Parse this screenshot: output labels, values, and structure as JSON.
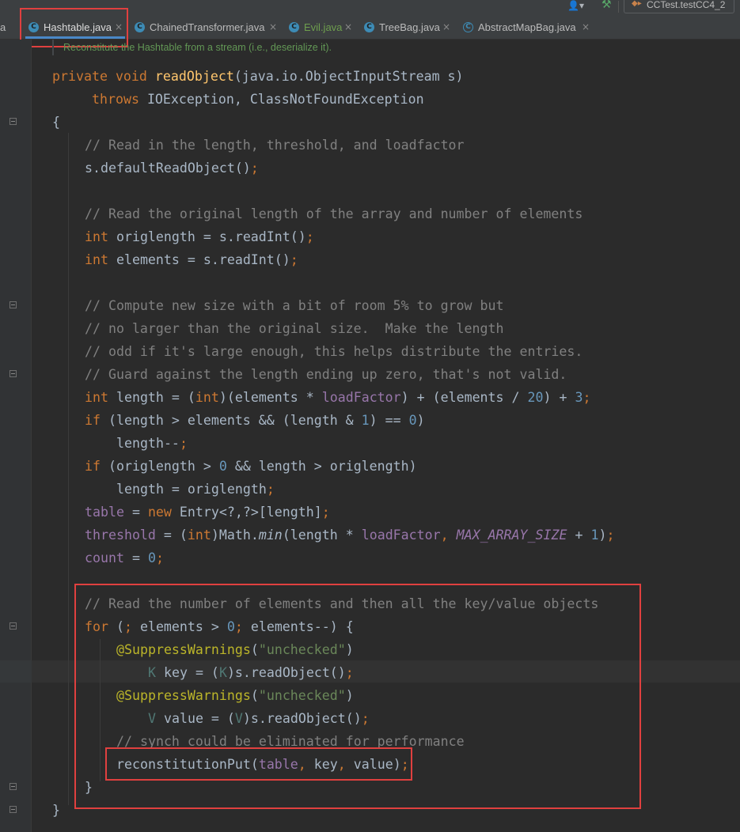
{
  "toolbar": {
    "user_icon": "👤▾",
    "build_icon": "hammer-icon",
    "run_config": "CCTest.testCC4_2"
  },
  "tabs": [
    {
      "label": "Hashtable.java",
      "icon": "C",
      "active": true
    },
    {
      "label": "ChainedTransformer.java",
      "icon": "C"
    },
    {
      "label": "Evil.java",
      "icon": "C",
      "color": "#6e9e4e"
    },
    {
      "label": "TreeBag.java",
      "icon": "C"
    },
    {
      "label": "AbstractMapBag.java",
      "icon": "C",
      "abstract": true
    }
  ],
  "tab_partial": "a",
  "close_glyph": "×",
  "doc_hint": "Reconstitute the Hashtable from a stream (i.e., deserialize it).",
  "code": {
    "l1": {
      "kw1": "private",
      "kw2": "void",
      "fn": "readObject",
      "rest": "(java.io.ObjectInputStream s)"
    },
    "l2": {
      "kw": "throws",
      "rest": " IOException, ClassNotFoundException"
    },
    "l3": "{",
    "l4": "// Read in the length, threshold, and loadfactor",
    "l5": {
      "text": "s.defaultReadObject()",
      "semi": ";"
    },
    "l7": "// Read the original length of the array and number of elements",
    "l8": {
      "kw": "int",
      "mid": " origlength = s.readInt()",
      "semi": ";"
    },
    "l9": {
      "kw": "int",
      "mid": " elements = s.readInt()",
      "semi": ";"
    },
    "l11": "// Compute new size with a bit of room 5% to grow but",
    "l12": "// no larger than the original size.  Make the length",
    "l13": "// odd if it's large enough, this helps distribute the entries.",
    "l14": "// Guard against the length ending up zero, that's not valid.",
    "l15": {
      "kw": "int",
      "a": " length = (",
      "kw2": "int",
      "b": ")(elements * ",
      "fld": "loadFactor",
      "c": ") + (elements / ",
      "n1": "20",
      "d": ") + ",
      "n2": "3",
      "semi": ";"
    },
    "l16": {
      "kw": "if",
      "a": " (length > elements && (length & ",
      "n1": "1",
      "b": ") == ",
      "n2": "0",
      "c": ")"
    },
    "l17": {
      "text": "length--",
      "semi": ";"
    },
    "l18": {
      "kw": "if",
      "a": " (origlength > ",
      "n": "0",
      "b": " && length > origlength)"
    },
    "l19": {
      "text": "length = origlength",
      "semi": ";"
    },
    "l20": {
      "fld": "table",
      "a": " = ",
      "kw": "new",
      "b": " Entry<?,?>[length]",
      "semi": ";"
    },
    "l21": {
      "fld": "threshold",
      "a": " = (",
      "kw": "int",
      "b": ")Math.",
      "m": "min",
      "c": "(length * ",
      "fld2": "loadFactor",
      "d": ", ",
      "st": "MAX_ARRAY_SIZE",
      "e": " + ",
      "n": "1",
      "f": ")",
      "semi": ";"
    },
    "l22": {
      "fld": "count",
      "a": " = ",
      "n": "0",
      "semi": ";"
    },
    "l24": "// Read the number of elements and then all the key/value objects",
    "l25": {
      "kw": "for",
      "a": " (",
      "s1": ";",
      "b": " elements > ",
      "n": "0",
      "s2": ";",
      "c": " elements--) {"
    },
    "l26": {
      "ann": "@SuppressWarnings",
      "a": "(",
      "str": "\"unchecked\"",
      "b": ")"
    },
    "l27": {
      "tp": "K",
      "a": " key = (",
      "tp2": "K",
      "b": ")s.readObject()",
      "semi": ";"
    },
    "l28": {
      "ann": "@SuppressWarnings",
      "a": "(",
      "str": "\"unchecked\"",
      "b": ")"
    },
    "l29": {
      "tp": "V",
      "a": " value = (",
      "tp2": "V",
      "b": ")s.readObject()",
      "semi": ";"
    },
    "l30": "// synch could be eliminated for performance",
    "l31": {
      "a": "reconstitutionPut(",
      "fld": "table",
      "s1": ",",
      "b": " key",
      "s2": ",",
      "c": " value)",
      "semi": ";"
    },
    "l32": "}",
    "l33": "}"
  }
}
